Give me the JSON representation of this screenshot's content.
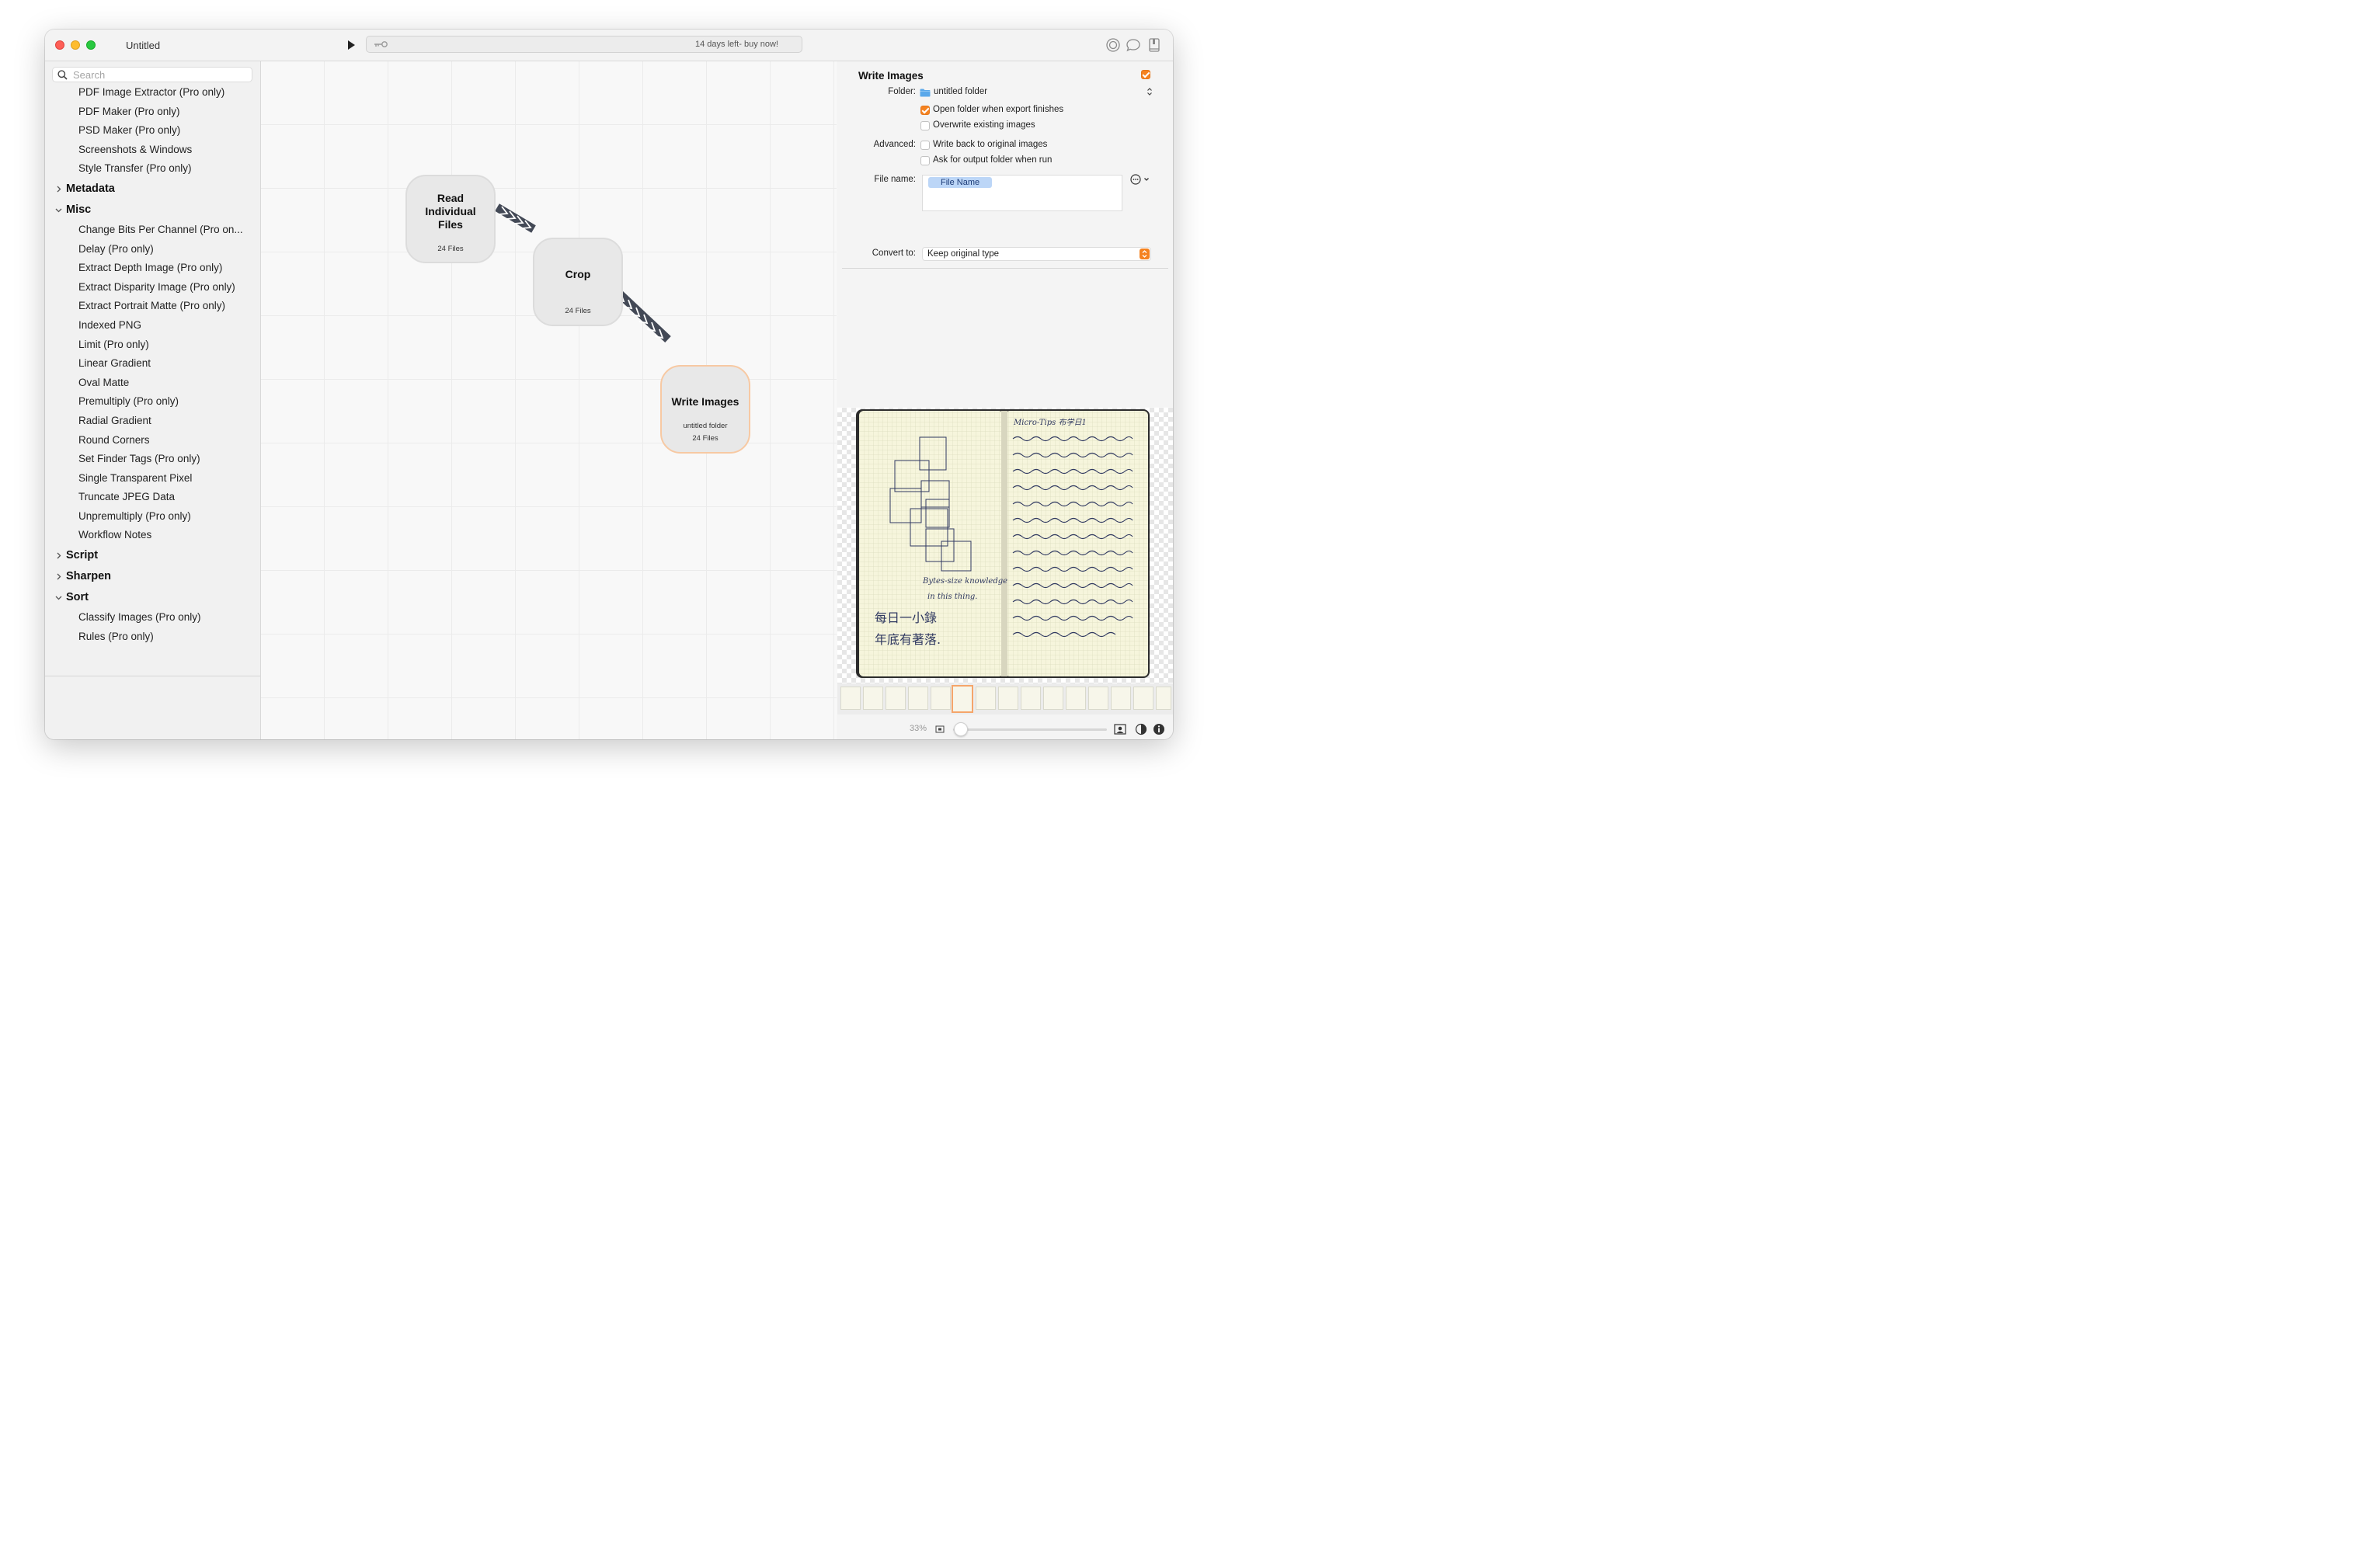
{
  "window": {
    "title": "Untitled"
  },
  "toolbar": {
    "trial_text": "14 days left- buy now!"
  },
  "sidebar": {
    "search_placeholder": "Search",
    "items_top": [
      "PDF Image Extractor (Pro only)",
      "PDF Maker (Pro only)",
      "PSD Maker (Pro only)",
      "Screenshots & Windows",
      "Style Transfer (Pro only)"
    ],
    "group_metadata": "Metadata",
    "group_misc": "Misc",
    "items_misc": [
      "Change Bits Per Channel (Pro on...",
      "Delay (Pro only)",
      "Extract Depth Image (Pro only)",
      "Extract Disparity Image (Pro only)",
      "Extract Portrait Matte (Pro only)",
      "Indexed PNG",
      "Limit (Pro only)",
      "Linear Gradient",
      "Oval Matte",
      "Premultiply (Pro only)",
      "Radial Gradient",
      "Round Corners",
      "Set Finder Tags (Pro only)",
      "Single Transparent Pixel",
      "Truncate JPEG Data",
      "Unpremultiply (Pro only)",
      "Workflow Notes"
    ],
    "group_script": "Script",
    "group_sharpen": "Sharpen",
    "group_sort": "Sort",
    "items_sort": [
      "Classify Images (Pro only)",
      "Rules (Pro only)"
    ]
  },
  "nodes": {
    "read": {
      "title": "Read Individual Files",
      "count": "24 Files"
    },
    "crop": {
      "title": "Crop",
      "count": "24 Files"
    },
    "write": {
      "title": "Write Images",
      "folder": "untitled folder",
      "count": "24 Files"
    }
  },
  "panel": {
    "title": "Write Images",
    "folder_label": "Folder:",
    "folder_value": "untitled folder",
    "open_folder": "Open folder when export finishes",
    "overwrite": "Overwrite existing images",
    "advanced_label": "Advanced:",
    "write_back": "Write back to original images",
    "ask_output": "Ask for output folder when run",
    "file_name_label": "File name:",
    "file_name_token": "File Name",
    "convert_label": "Convert to:",
    "convert_value": "Keep original type"
  },
  "preview": {
    "zoom": "33%",
    "handwriting_left": [
      "Bytes-size knowledge",
      "in this thing.",
      "每日一小錄",
      "年底有著落."
    ],
    "handwriting_right_header": "Micro-Tips 布学日1"
  },
  "colors": {
    "accent": "#f5821f",
    "token": "#bcd6f7",
    "node_border_active": "#f7c9a3"
  }
}
